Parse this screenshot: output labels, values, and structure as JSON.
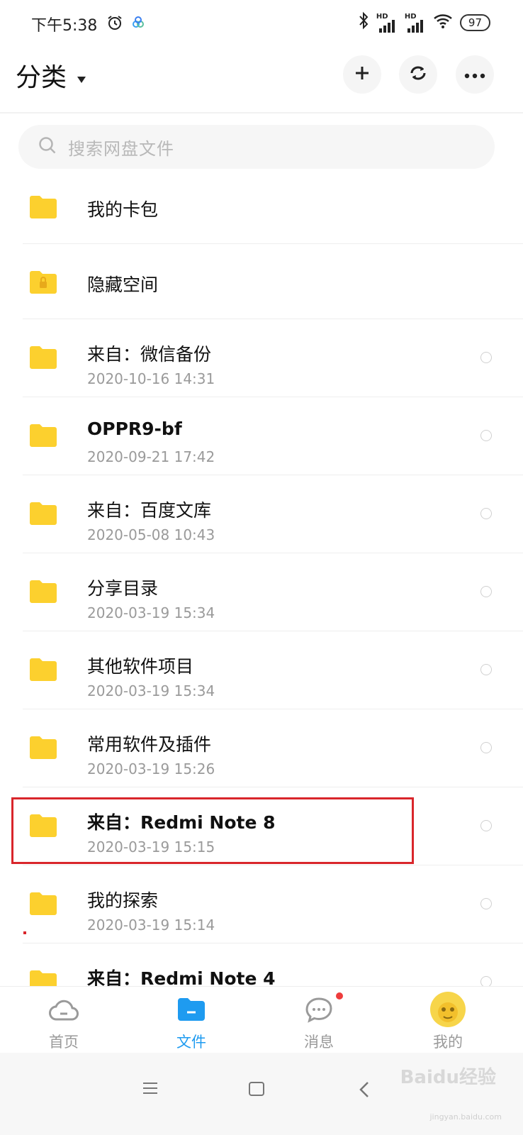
{
  "status_bar": {
    "time": "下午5:38",
    "battery": "97",
    "hd_label": "HD"
  },
  "header": {
    "title": "分类"
  },
  "search": {
    "placeholder": "搜索网盘文件"
  },
  "files": [
    {
      "name": "我的卡包",
      "date": "",
      "type": "folder"
    },
    {
      "name": "隐藏空间",
      "date": "",
      "type": "locked-folder"
    },
    {
      "name": "来自：微信备份",
      "date": "2020-10-16  14:31",
      "type": "folder"
    },
    {
      "name": "OPPR9-bf",
      "date": "2020-09-21  17:42",
      "type": "folder"
    },
    {
      "name": "来自：百度文库",
      "date": "2020-05-08  10:43",
      "type": "folder"
    },
    {
      "name": "分享目录",
      "date": "2020-03-19  15:34",
      "type": "folder"
    },
    {
      "name": "其他软件项目",
      "date": "2020-03-19  15:34",
      "type": "folder"
    },
    {
      "name": "常用软件及插件",
      "date": "2020-03-19  15:26",
      "type": "folder"
    },
    {
      "name": "来自：Redmi Note 8",
      "date": "2020-03-19  15:15",
      "type": "folder",
      "highlighted": true
    },
    {
      "name": "我的探索",
      "date": "2020-03-19  15:14",
      "type": "folder"
    },
    {
      "name": "来自：Redmi Note 4",
      "date": "",
      "type": "folder"
    }
  ],
  "tabs": [
    {
      "label": "首页",
      "icon": "cloud-icon",
      "active": false
    },
    {
      "label": "文件",
      "icon": "folder-icon",
      "active": true
    },
    {
      "label": "消息",
      "icon": "chat-icon",
      "active": false,
      "has_badge": true
    },
    {
      "label": "我的",
      "icon": "avatar",
      "active": false
    }
  ],
  "watermark": {
    "text": "Baidu经验",
    "url_text": "jingyan.baidu.com"
  },
  "colors": {
    "accent": "#1e9bf0",
    "folder": "#fcd02e",
    "highlight_box": "#d9262b",
    "badge": "#ee3c3c"
  }
}
